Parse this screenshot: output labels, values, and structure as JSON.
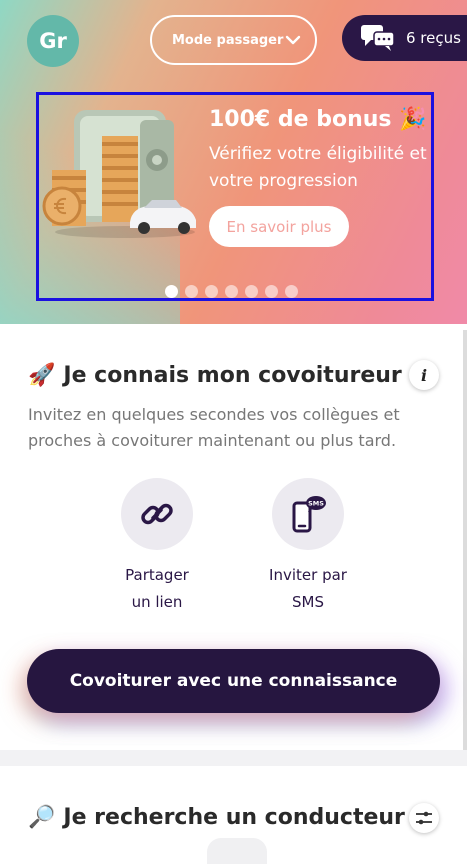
{
  "header": {
    "avatar_initials": "Gr",
    "mode_label": "Mode passager",
    "received_label": "6 reçus"
  },
  "banner": {
    "title": "100€ de bonus 🎉",
    "subtitle": "Vérifiez votre éligibilité et votre progression",
    "cta_label": "En savoir plus",
    "slide_count": 7,
    "active_slide": 1
  },
  "known_section": {
    "emoji": "🚀",
    "title": "Je connais mon covoitureur",
    "description": "Invitez en quelques secondes vos collègues et proches à covoiturer maintenant ou plus tard.",
    "share_link_label_line1": "Partager",
    "share_link_label_line2": "un lien",
    "invite_sms_label_line1": "Inviter par",
    "invite_sms_label_line2": "SMS",
    "sms_badge": "SMS",
    "cta_label": "Covoiturer avec une connaissance"
  },
  "search_section": {
    "emoji": "🔎",
    "title": "Je recherche un conducteur"
  },
  "colors": {
    "brand_dark": "#261640",
    "avatar_bg": "#63b8a9",
    "banner_frame": "#1a10e0"
  }
}
